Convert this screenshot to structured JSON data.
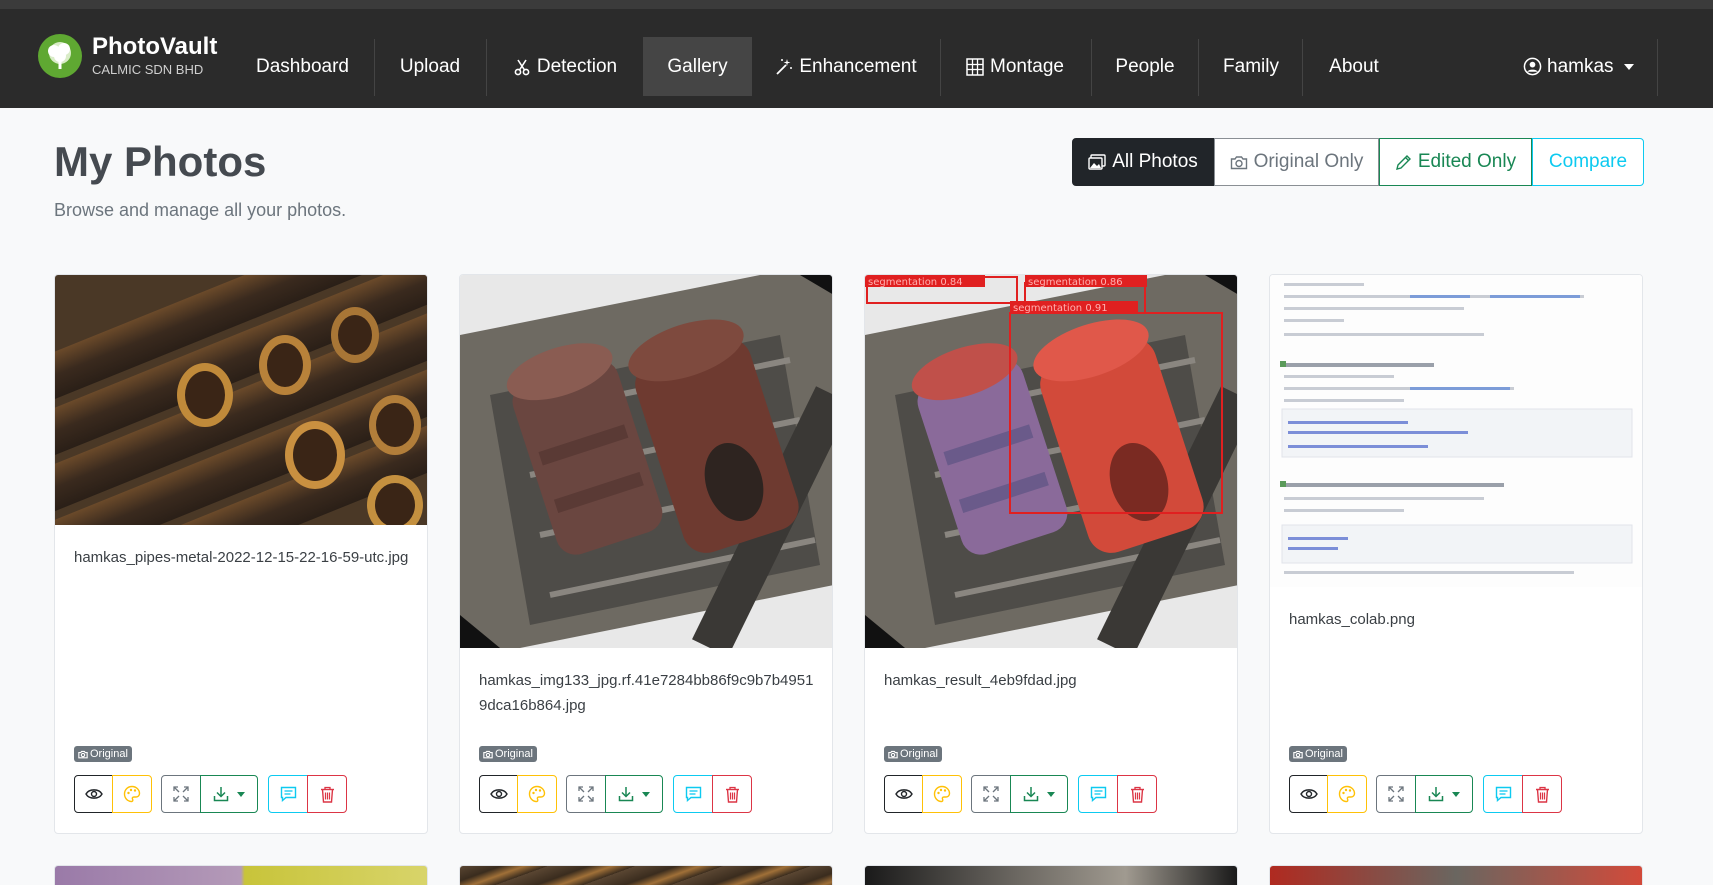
{
  "brand": {
    "name": "PhotoVault",
    "subtitle": "CALMIC SDN BHD"
  },
  "nav": {
    "items": [
      {
        "label": "Dashboard",
        "icon": ""
      },
      {
        "label": "Upload",
        "icon": ""
      },
      {
        "label": "Detection",
        "icon": "scissors-icon"
      },
      {
        "label": "Gallery",
        "icon": "",
        "active": true
      },
      {
        "label": "Enhancement",
        "icon": "magic-wand-icon"
      },
      {
        "label": "Montage",
        "icon": "grid-icon"
      },
      {
        "label": "People",
        "icon": ""
      },
      {
        "label": "Family",
        "icon": ""
      },
      {
        "label": "About",
        "icon": ""
      }
    ],
    "user": "hamkas"
  },
  "page": {
    "title": "My Photos",
    "subtitle": "Browse and manage all your photos."
  },
  "filters": {
    "all": "All Photos",
    "original": "Original Only",
    "edited": "Edited Only",
    "compare": "Compare",
    "active": "all"
  },
  "photos": [
    {
      "filename": "hamkas_pipes-metal-2022-12-15-22-16-59-utc.jpg",
      "badge": "Original",
      "thumbnail": "rusty-pipes"
    },
    {
      "filename": "hamkas_img133_jpg.rf.41e7284bb86f9c9b7b49519dca16b864.jpg",
      "badge": "Original",
      "thumbnail": "rusty-parts"
    },
    {
      "filename": "hamkas_result_4eb9fdad.jpg",
      "badge": "Original",
      "thumbnail": "segmentation-result"
    },
    {
      "filename": "hamkas_colab.png",
      "badge": "Original",
      "thumbnail": "colab-screenshot"
    }
  ],
  "colors": {
    "navbar": "#2b2b2b",
    "brand_green": "#5fa832",
    "success": "#198754",
    "info": "#0dcaf0",
    "warning": "#ffc107",
    "danger": "#dc3545"
  }
}
